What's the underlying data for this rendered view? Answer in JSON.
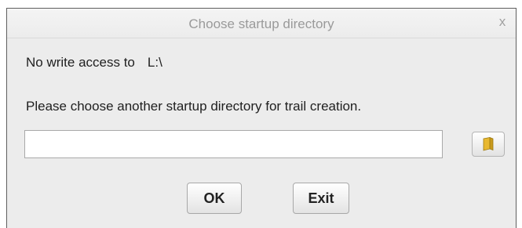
{
  "dialog": {
    "title": "Choose startup directory",
    "close_glyph": "x"
  },
  "message": {
    "no_access_label": "No write access to",
    "path": "L:\\",
    "instruction": "Please choose another startup directory for trail creation."
  },
  "directory_input": {
    "value": "",
    "placeholder": ""
  },
  "browse_button": {
    "icon": "folder-icon"
  },
  "buttons": {
    "ok_label": "OK",
    "exit_label": "Exit"
  },
  "colors": {
    "dialog_bg": "#ececec",
    "title_text": "#9a9a9a",
    "folder_yellow": "#e8b830"
  }
}
